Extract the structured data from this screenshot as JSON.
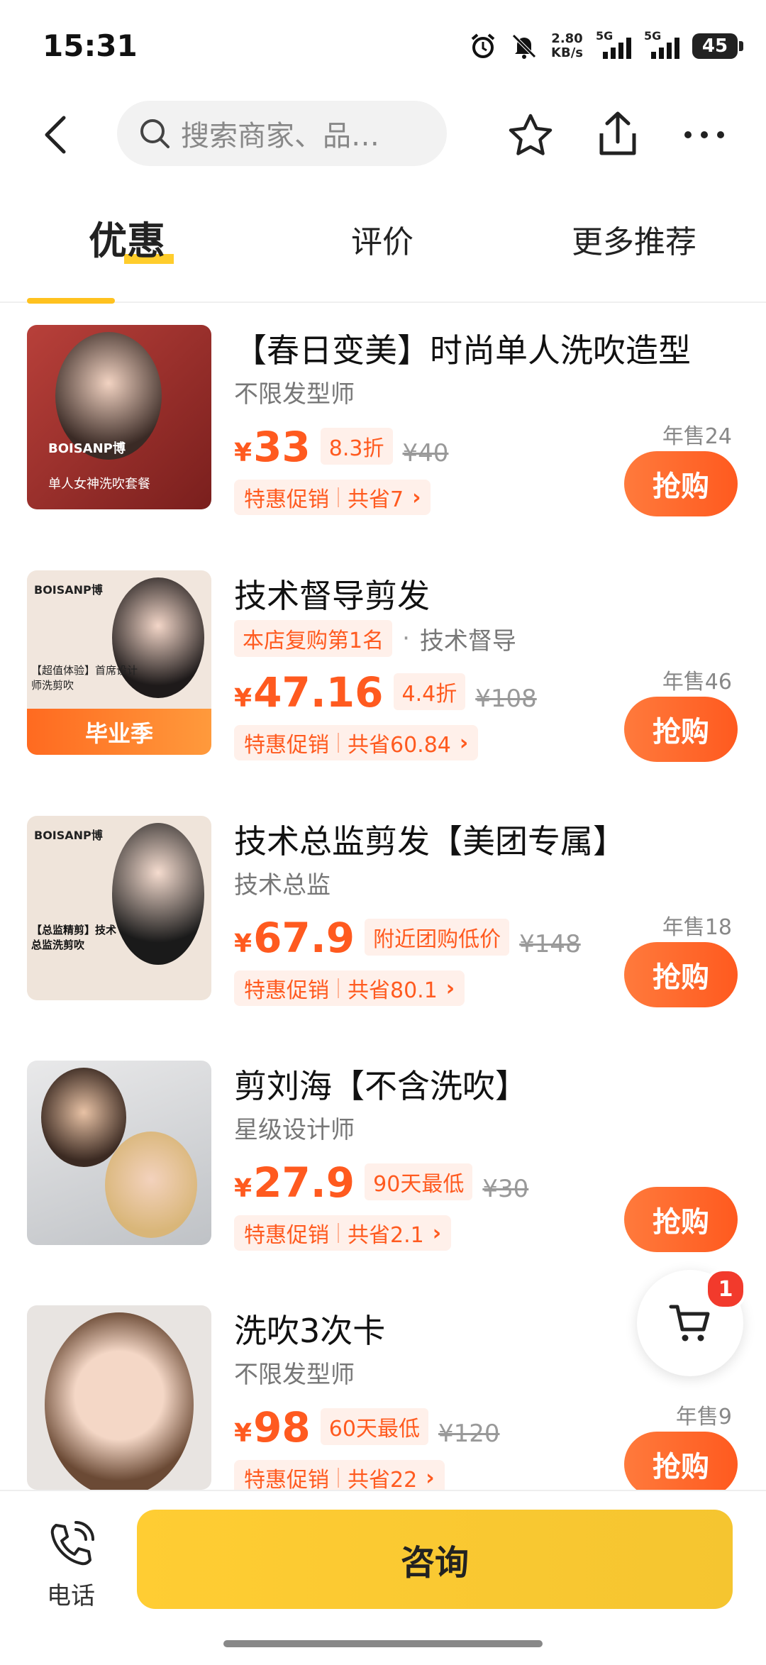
{
  "status_bar": {
    "time": "15:31",
    "net_speed_value": "2.80",
    "net_speed_unit": "KB/s",
    "signal1_label": "5G",
    "signal2_label": "5G",
    "battery": "45",
    "icons": [
      "alarm-icon",
      "mute-bell-icon"
    ]
  },
  "nav": {
    "search_placeholder": "搜索商家、品…",
    "icons": [
      "back-icon",
      "search-icon",
      "star-icon",
      "share-icon",
      "more-icon"
    ]
  },
  "tabs": [
    {
      "label": "优惠",
      "active": true
    },
    {
      "label": "评价",
      "active": false
    },
    {
      "label": "更多推荐",
      "active": false
    }
  ],
  "deals": [
    {
      "title": "【春日变美】时尚单人洗吹造型",
      "subtitle": "不限发型师",
      "rank_badge": "",
      "yen": "¥",
      "price": "33",
      "discount_tag": "8.3折",
      "original_price": "¥40",
      "promo_label": "特惠促销",
      "promo_saving": "共省7",
      "sold": "年售24",
      "buy_label": "抢购",
      "thumb_brand": "BOISANP博",
      "thumb_caption": "单人女神洗吹套餐"
    },
    {
      "title": "技术督导剪发",
      "subtitle": "技术督导",
      "rank_badge": "本店复购第1名",
      "yen": "¥",
      "price": "47.16",
      "discount_tag": "4.4折",
      "original_price": "¥108",
      "promo_label": "特惠促销",
      "promo_saving": "共省60.84",
      "sold": "年售46",
      "buy_label": "抢购",
      "thumb_brand": "BOISANP博",
      "thumb_caption": "【超值体验】首席设计师洗剪吹",
      "thumb_banner": "毕业季"
    },
    {
      "title": "技术总监剪发【美团专属】",
      "subtitle": "技术总监",
      "rank_badge": "",
      "yen": "¥",
      "price": "67.9",
      "discount_tag": "附近团购低价",
      "original_price": "¥148",
      "promo_label": "特惠促销",
      "promo_saving": "共省80.1",
      "sold": "年售18",
      "buy_label": "抢购",
      "thumb_brand": "BOISANP博",
      "thumb_caption": "【总监精剪】技术总监洗剪吹"
    },
    {
      "title": "剪刘海【不含洗吹】",
      "subtitle": "星级设计师",
      "rank_badge": "",
      "yen": "¥",
      "price": "27.9",
      "discount_tag": "90天最低",
      "original_price": "¥30",
      "promo_label": "特惠促销",
      "promo_saving": "共省2.1",
      "sold": "",
      "buy_label": "抢购"
    },
    {
      "title": "洗吹3次卡",
      "subtitle": "不限发型师",
      "rank_badge": "",
      "yen": "¥",
      "price": "98",
      "discount_tag": "60天最低",
      "original_price": "¥120",
      "promo_label": "特惠促销",
      "promo_saving": "共省22",
      "sold": "年售9",
      "buy_label": "抢购"
    }
  ],
  "cart": {
    "badge_count": "1"
  },
  "bottom_bar": {
    "phone_label": "电话",
    "consult_label": "咨询"
  },
  "colors": {
    "accent_orange": "#ff5a1f",
    "accent_yellow": "#ffc21f",
    "badge_red": "#f23a2c"
  }
}
